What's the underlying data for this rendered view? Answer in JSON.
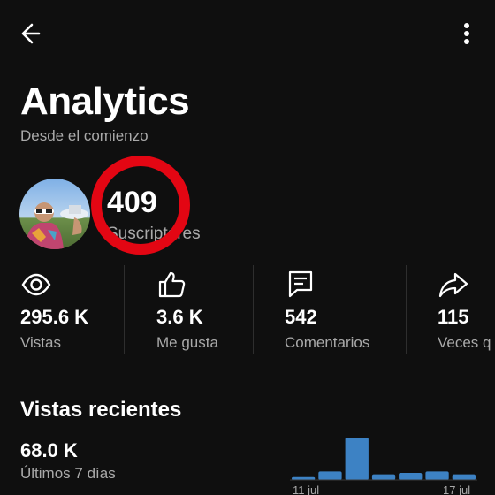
{
  "header": {
    "title": "Analytics",
    "subtitle": "Desde el comienzo"
  },
  "channel": {
    "subscribers_value": "409",
    "subscribers_label": "Suscriptores",
    "highlight_color": "#e30613"
  },
  "stats": [
    {
      "icon": "eye-icon",
      "value": "295.6 K",
      "label": "Vistas"
    },
    {
      "icon": "thumbs-up-icon",
      "value": "3.6 K",
      "label": "Me gusta"
    },
    {
      "icon": "comment-icon",
      "value": "542",
      "label": "Comentarios"
    },
    {
      "icon": "share-icon",
      "value": "115",
      "label": "Veces q"
    }
  ],
  "recent": {
    "title": "Vistas recientes",
    "value": "68.0 K",
    "period_label": "Últimos 7 días"
  },
  "chart_data": {
    "type": "bar",
    "categories": [
      "",
      "",
      "",
      "",
      "",
      "",
      ""
    ],
    "tick_labels": [
      "11 jul",
      "17 jul"
    ],
    "values": [
      2,
      6,
      30,
      4,
      5,
      6,
      4
    ],
    "color": "#3d82c4",
    "title": "",
    "xlabel": "",
    "ylabel": ""
  },
  "colors": {
    "background": "#0f0f0f",
    "text_secondary": "#aaaaaa",
    "accent_bar": "#3d82c4"
  }
}
